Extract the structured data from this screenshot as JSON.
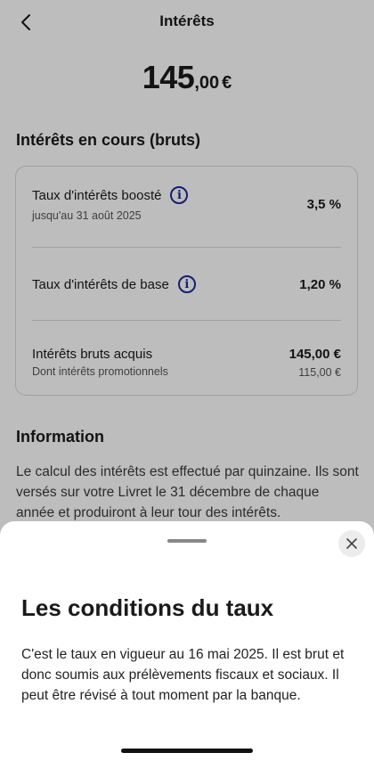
{
  "header": {
    "title": "Intérêts"
  },
  "amount": {
    "integer": "145",
    "decimal": ",00",
    "currency": "€"
  },
  "current_interests": {
    "title": "Intérêts en cours (bruts)",
    "boosted": {
      "label": "Taux d'intérêts boosté",
      "sub": "jusqu'au 31 août 2025",
      "value": "3,5 %",
      "icon": "info-icon"
    },
    "base": {
      "label": "Taux d'intérêts de base",
      "value": "1,20 %",
      "icon": "info-icon"
    },
    "acquired": {
      "label": "Intérêts bruts acquis",
      "sub": "Dont intérêts promotionnels",
      "value": "145,00 €",
      "sub_value": "115,00 €"
    }
  },
  "information": {
    "title": "Information",
    "text": "Le calcul des intérêts est effectué par quinzaine. Ils sont versés sur votre Livret le 31 décembre de chaque année et produiront à leur tour des intérêts."
  },
  "sheet": {
    "title": "Les conditions du taux",
    "text": "C'est le taux en vigueur au 16 mai 2025. Il est brut et donc soumis aux prélèvements fiscaux et sociaux. Il peut être révisé à tout moment par la banque.",
    "close_icon": "close-icon"
  },
  "colors": {
    "accent": "#1c2a9c",
    "overlay": "rgba(0,0,0,0.26)"
  }
}
